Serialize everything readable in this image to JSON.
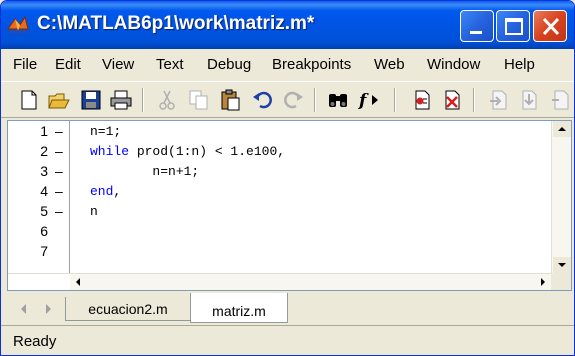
{
  "window": {
    "title": "C:\\MATLAB6p1\\work\\matriz.m*"
  },
  "menu": [
    "File",
    "Edit",
    "View",
    "Text",
    "Debug",
    "Breakpoints",
    "Web",
    "Window",
    "Help"
  ],
  "toolbar": {
    "icons": [
      "new-file-icon",
      "open-folder-icon",
      "save-icon",
      "print-icon",
      "cut-icon",
      "copy-icon",
      "paste-icon",
      "undo-icon",
      "redo-icon",
      "find-binoculars-icon",
      "function-icon",
      "set-breakpoint-icon",
      "clear-breakpoint-icon",
      "step-icon",
      "step-in-icon"
    ]
  },
  "editor": {
    "line_numbers": [
      "1",
      "2",
      "3",
      "4",
      "5",
      "6",
      "7"
    ],
    "dashes": [
      "–",
      "–",
      "–",
      "–",
      "–",
      "",
      ""
    ],
    "lines": [
      {
        "indent": "",
        "keyword": "",
        "text": "n=1;"
      },
      {
        "indent": "",
        "keyword": "while",
        "text": " prod(1:n) < 1.e100,"
      },
      {
        "indent": "        ",
        "keyword": "",
        "text": "n=n+1;"
      },
      {
        "indent": "",
        "keyword": "end",
        "text": ","
      },
      {
        "indent": "",
        "keyword": "",
        "text": "n"
      },
      {
        "indent": "",
        "keyword": "",
        "text": ""
      },
      {
        "indent": "",
        "keyword": "",
        "text": ""
      }
    ]
  },
  "tabs": [
    {
      "label": "ecuacion2.m",
      "active": false
    },
    {
      "label": "matriz.m",
      "active": true
    }
  ],
  "status": {
    "text": "Ready"
  },
  "colors": {
    "titlebar": "#0054e3",
    "keyword": "#0000ff",
    "close": "#d8431f"
  }
}
